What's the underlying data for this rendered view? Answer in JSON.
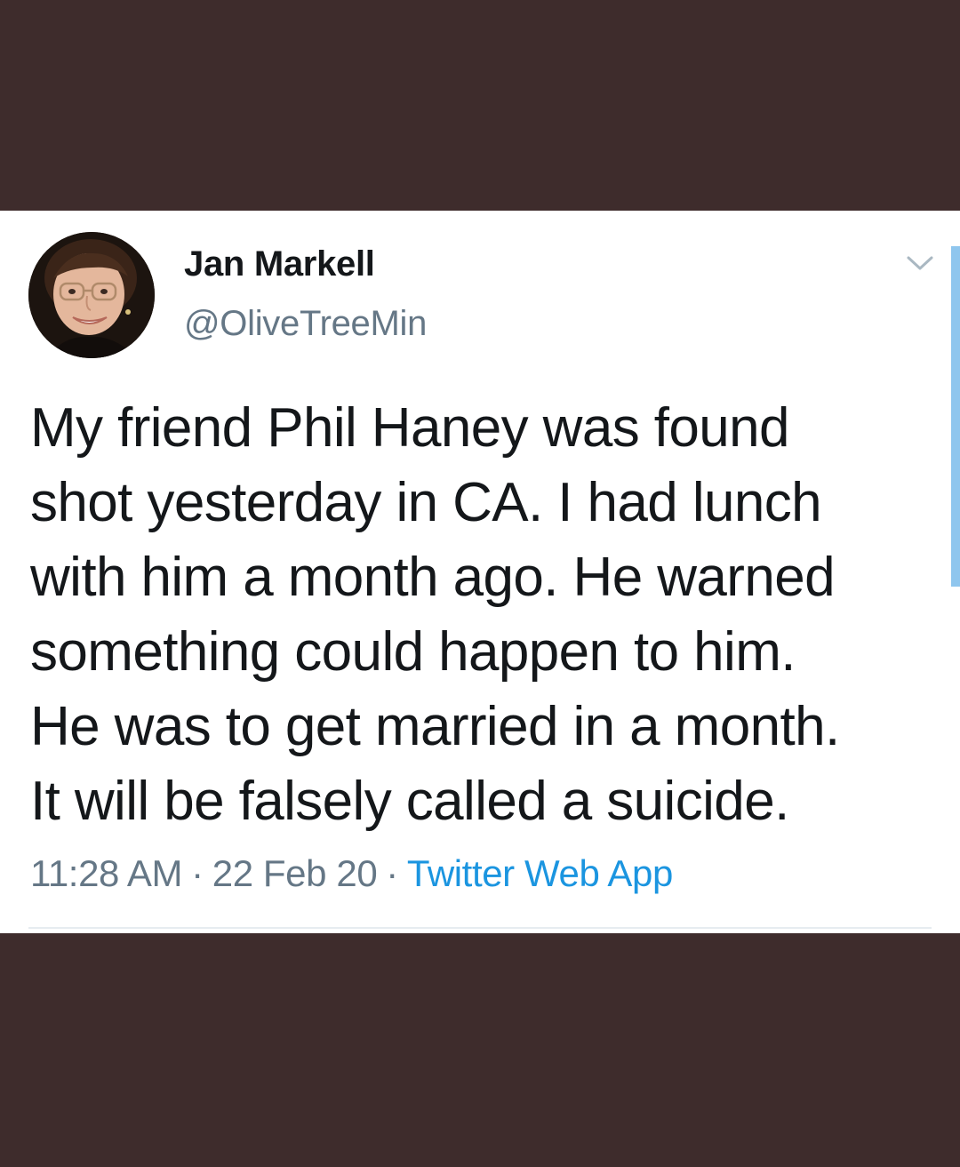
{
  "tweet": {
    "author_name": "Jan Markell",
    "author_handle": "@OliveTreeMin",
    "text_lines": [
      "My friend Phil Haney was found",
      "shot yesterday in CA. I had lunch",
      "with him a month ago. He warned",
      "something could happen to him.",
      "He was to get married in a month.",
      "It will be falsely called a suicide."
    ],
    "time": "11:28 AM",
    "separator": "·",
    "date": "22 Feb 20",
    "source": "Twitter Web App",
    "menu_icon": "chevron-down-icon"
  },
  "colors": {
    "background": "#3e2c2c",
    "card": "#ffffff",
    "text": "#14171a",
    "secondary_text": "#657786",
    "link": "#1b95e0",
    "scroll_indicator": "#8fc6ee"
  }
}
